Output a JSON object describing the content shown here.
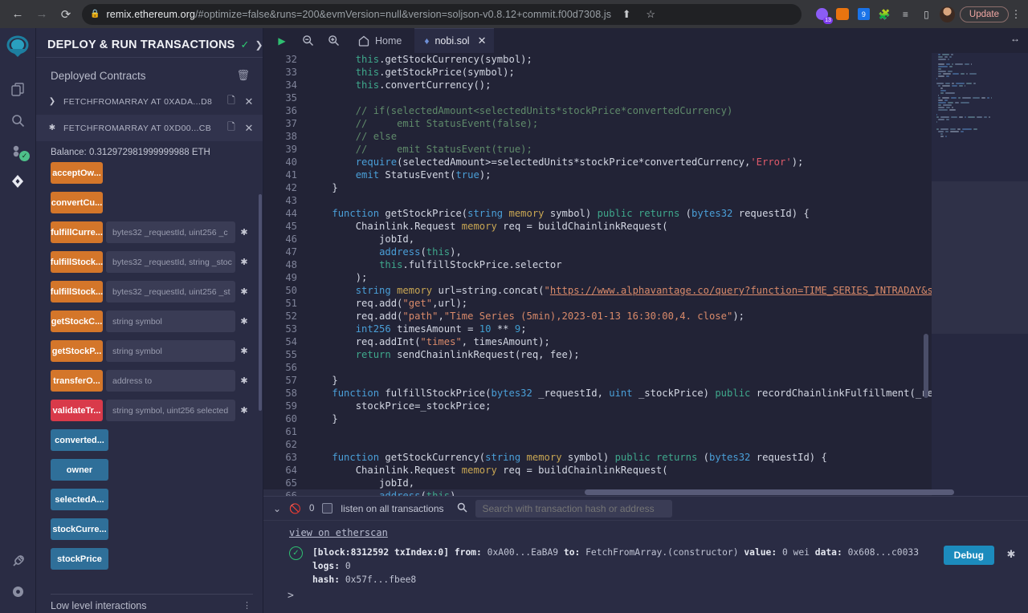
{
  "browser": {
    "back_icon": "back-arrow",
    "forward_icon": "forward-arrow",
    "reload_icon": "reload",
    "url_host": "remix.ethereum.org",
    "url_path": "/#optimize=false&runs=200&evmVersion=null&version=soljson-v0.8.12+commit.f00d7308.js",
    "share_icon": "share",
    "bookmark_icon": "star",
    "extension_badge": "13",
    "update_label": "Update",
    "menu_icon": "kebab-menu"
  },
  "rail": {
    "items": [
      {
        "name": "home-logo",
        "icon": "remix-logo"
      },
      {
        "name": "file-explorer",
        "icon": "files-icon"
      },
      {
        "name": "search",
        "icon": "search-icon"
      },
      {
        "name": "solidity-compiler",
        "icon": "compiler-icon",
        "badge": "check"
      },
      {
        "name": "deploy-run",
        "icon": "deploy-icon"
      },
      {
        "name": "plugin-manager",
        "icon": "plug-icon"
      },
      {
        "name": "settings",
        "icon": "gear-icon"
      }
    ]
  },
  "panel": {
    "title": "DEPLOY & RUN TRANSACTIONS",
    "deployed_title": "Deployed Contracts",
    "trash_icon": "trash-icon",
    "contracts": [
      {
        "label": "FETCHFROMARRAY AT 0XADA...D8",
        "expanded": false
      },
      {
        "label": "FETCHFROMARRAY AT 0XD00...CB",
        "expanded": true
      }
    ],
    "balance": "Balance: 0.312972981999999988 ETH",
    "functions": [
      {
        "label": "acceptOw...",
        "color": "orange",
        "args": ""
      },
      {
        "label": "convertCu...",
        "color": "orange",
        "args": ""
      },
      {
        "label": "fulfillCurre...",
        "color": "orange",
        "args": "bytes32 _requestId, uint256 _c"
      },
      {
        "label": "fulfillStock...",
        "color": "orange",
        "args": "bytes32 _requestId, string _stoc"
      },
      {
        "label": "fulfillStock...",
        "color": "orange",
        "args": "bytes32 _requestId, uint256 _st"
      },
      {
        "label": "getStockC...",
        "color": "orange",
        "args": "string symbol"
      },
      {
        "label": "getStockP...",
        "color": "orange",
        "args": "string symbol"
      },
      {
        "label": "transferO...",
        "color": "orange",
        "args": "address to"
      },
      {
        "label": "validateTr...",
        "color": "red",
        "args": "string symbol, uint256 selected"
      },
      {
        "label": "converted...",
        "color": "blue",
        "args": ""
      },
      {
        "label": "owner",
        "color": "blue",
        "args": ""
      },
      {
        "label": "selectedA...",
        "color": "blue",
        "args": ""
      },
      {
        "label": "stockCurre...",
        "color": "blue",
        "args": ""
      },
      {
        "label": "stockPrice",
        "color": "blue",
        "args": ""
      }
    ],
    "lowlevel_title": "Low level interactions"
  },
  "editor": {
    "toolbar": {
      "run_icon": "play-icon",
      "zoom_out_icon": "zoom-out-icon",
      "zoom_in_icon": "zoom-in-icon",
      "home_label": "Home",
      "home_icon": "home-icon",
      "expand_icon": "expand-horizontal-icon"
    },
    "tab": {
      "label": "nobi.sol",
      "icon": "solidity-icon",
      "close_icon": "close-icon"
    },
    "first_line": 32,
    "lines": [
      {
        "n": 32,
        "html": "        <span class='tok-this'>this</span>.getStockCurrency(symbol);"
      },
      {
        "n": 33,
        "html": "        <span class='tok-this'>this</span>.getStockPrice(symbol);"
      },
      {
        "n": 34,
        "html": "        <span class='tok-this'>this</span>.convertCurrency();"
      },
      {
        "n": 35,
        "html": ""
      },
      {
        "n": 36,
        "html": "        <span class='tok-cmt'>// if(selectedAmount&lt;selectedUnits*stockPrice*convertedCurrency)</span>"
      },
      {
        "n": 37,
        "html": "        <span class='tok-cmt'>//     emit StatusEvent(false);</span>"
      },
      {
        "n": 38,
        "html": "        <span class='tok-cmt'>// else</span>"
      },
      {
        "n": 39,
        "html": "        <span class='tok-cmt'>//     emit StatusEvent(true);</span>"
      },
      {
        "n": 40,
        "html": "        <span class='tok-kw'>require</span>(selectedAmount&gt;=selectedUnits*stockPrice*convertedCurrency,<span class='tok-err'>'Error'</span>);"
      },
      {
        "n": 41,
        "html": "        <span class='tok-kw'>emit</span> StatusEvent(<span class='tok-kw'>true</span>);"
      },
      {
        "n": 42,
        "html": "    }"
      },
      {
        "n": 43,
        "html": ""
      },
      {
        "n": 44,
        "html": "    <span class='tok-kw'>function</span> getStockPrice(<span class='tok-type'>string</span> <span class='tok-mem'>memory</span> symbol) <span class='tok-vis'>public</span> <span class='tok-ret'>returns</span> (<span class='tok-type'>bytes32</span> requestId) {"
      },
      {
        "n": 45,
        "html": "        Chainlink.Request <span class='tok-mem'>memory</span> req = buildChainlinkRequest("
      },
      {
        "n": 46,
        "html": "            jobId,"
      },
      {
        "n": 47,
        "html": "            <span class='tok-kw'>address</span>(<span class='tok-this'>this</span>),"
      },
      {
        "n": 48,
        "html": "            <span class='tok-this'>this</span>.fulfillStockPrice.selector"
      },
      {
        "n": 49,
        "html": "        );"
      },
      {
        "n": 50,
        "html": "        <span class='tok-type'>string</span> <span class='tok-mem'>memory</span> url=string.concat(<span class='tok-str'>\"</span><span class='tok-url'>https://www.alphavantage.co/query?function=TIME_SERIES_INTRADAY&amp;symbol=</span><span class='tok-str'>\"</span>,symbo"
      },
      {
        "n": 51,
        "html": "        req.add(<span class='tok-str'>\"get\"</span>,url);"
      },
      {
        "n": 52,
        "html": "        req.add(<span class='tok-str'>\"path\"</span>,<span class='tok-str'>\"Time Series (5min),2023-01-13 16:30:00,4. close\"</span>);"
      },
      {
        "n": 53,
        "html": "        <span class='tok-type'>int256</span> timesAmount = <span class='tok-kw2'>10</span> ** <span class='tok-kw2'>9</span>;"
      },
      {
        "n": 54,
        "html": "        req.addInt(<span class='tok-str'>\"times\"</span>, timesAmount);"
      },
      {
        "n": 55,
        "html": "        <span class='tok-ret'>return</span> sendChainlinkRequest(req, fee);"
      },
      {
        "n": 56,
        "html": ""
      },
      {
        "n": 57,
        "html": "    }"
      },
      {
        "n": 58,
        "html": "    <span class='tok-kw'>function</span> fulfillStockPrice(<span class='tok-type'>bytes32</span> _requestId, <span class='tok-type'>uint</span> _stockPrice) <span class='tok-vis'>public</span> recordChainlinkFulfillment(_requestId) {"
      },
      {
        "n": 59,
        "html": "        stockPrice=_stockPrice;"
      },
      {
        "n": 60,
        "html": "    }"
      },
      {
        "n": 61,
        "html": ""
      },
      {
        "n": 62,
        "html": ""
      },
      {
        "n": 63,
        "html": "    <span class='tok-kw'>function</span> getStockCurrency(<span class='tok-type'>string</span> <span class='tok-mem'>memory</span> symbol) <span class='tok-vis'>public</span> <span class='tok-ret'>returns</span> (<span class='tok-type'>bytes32</span> requestId) {"
      },
      {
        "n": 64,
        "html": "        Chainlink.Request <span class='tok-mem'>memory</span> req = buildChainlinkRequest("
      },
      {
        "n": 65,
        "html": "            jobId,"
      },
      {
        "n": 66,
        "html": "            <span class='tok-kw'>address</span>(<span class='tok-this'>this</span>),"
      }
    ]
  },
  "terminal": {
    "collapse_icon": "chevrons-down-icon",
    "clear_icon": "no-entry-icon",
    "count": "0",
    "listen_label": "listen on all transactions",
    "search_icon": "search-icon",
    "search_placeholder": "Search with transaction hash or address",
    "etherscan_link": "view on etherscan",
    "tx": {
      "status_icon": "success-check-icon",
      "line1_parts": [
        {
          "t": "[block:8312592 txIndex:0]",
          "b": true
        },
        {
          "t": "  from:",
          "b": true
        },
        {
          "t": " 0xA00...EaBA9 ",
          "b": false
        },
        {
          "t": "to:",
          "b": true
        },
        {
          "t": " FetchFromArray.(constructor) ",
          "b": false
        },
        {
          "t": "value:",
          "b": true
        },
        {
          "t": " 0 wei ",
          "b": false
        },
        {
          "t": "data:",
          "b": true
        },
        {
          "t": " 0x608...c0033 ",
          "b": false
        },
        {
          "t": "logs:",
          "b": true
        },
        {
          "t": " 0",
          "b": false
        }
      ],
      "line2_parts": [
        {
          "t": "hash:",
          "b": true
        },
        {
          "t": " 0x57f...fbee8",
          "b": false
        }
      ],
      "debug_label": "Debug",
      "expand_icon": "chevron-down-icon"
    },
    "prompt": ">"
  }
}
